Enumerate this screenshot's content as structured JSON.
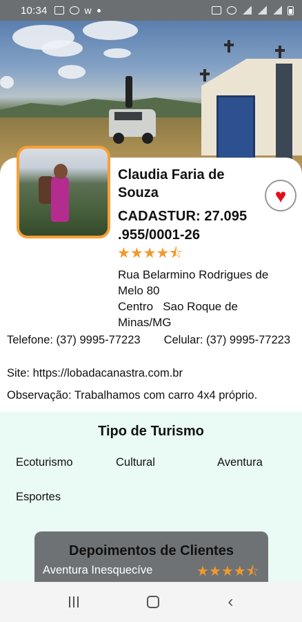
{
  "status_bar": {
    "time": "10:34"
  },
  "profile": {
    "name": "Claudia Faria de Souza",
    "cadastur": "CADASTUR: 27.095 .955/0001-26",
    "rating_stars": "★★★★⯪",
    "rating": 4.5,
    "address": "Rua Belarmino Rodrigues de Melo 80",
    "city_line": "Centro   Sao Roque de Minas/MG",
    "phone": "Telefone: (37) 9995-77223",
    "mobile": "Celular: (37) 9995-77223",
    "site": "Site: https://lobadacanastra.com.br",
    "observation": "Observação: Trabalhamos com carro 4x4 próprio."
  },
  "favorite": {
    "icon": "heart-icon",
    "color": "#e30e1c"
  },
  "tourism": {
    "title": "Tipo de Turismo",
    "types": [
      "Ecoturismo",
      "Cultural",
      "Aventura",
      "Esportes"
    ]
  },
  "testimonials": {
    "title": "Depoimentos de Clientes",
    "review_title": "Aventura Inesquecíve",
    "rating_stars": "★★★★⯪",
    "rating": 4.5
  },
  "colors": {
    "accent": "#f6a036",
    "star": "#f19a2b",
    "section_bg": "#eafaf4",
    "card_bg": "#6f7275"
  }
}
